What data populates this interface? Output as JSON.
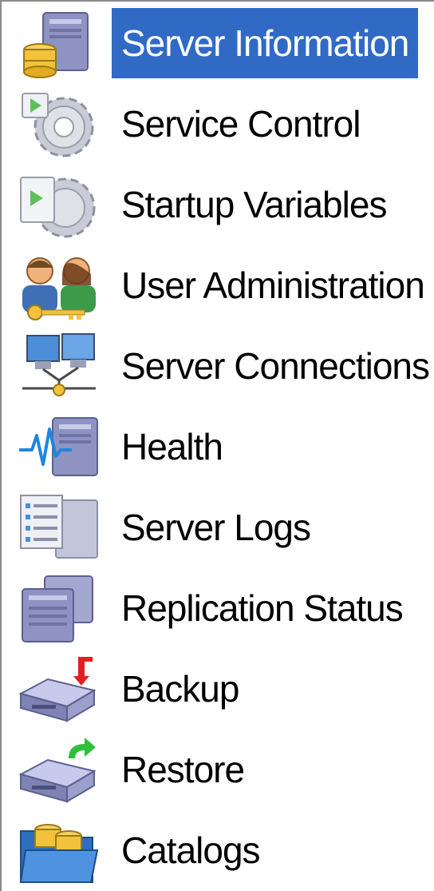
{
  "nav": {
    "items": [
      {
        "label": "Server Information",
        "icon": "server-database-icon",
        "selected": true
      },
      {
        "label": "Service Control",
        "icon": "service-gear-icon",
        "selected": false
      },
      {
        "label": "Startup Variables",
        "icon": "startup-gear-icon",
        "selected": false
      },
      {
        "label": "User Administration",
        "icon": "users-key-icon",
        "selected": false
      },
      {
        "label": "Server Connections",
        "icon": "network-computers-icon",
        "selected": false
      },
      {
        "label": "Health",
        "icon": "health-pulse-icon",
        "selected": false
      },
      {
        "label": "Server Logs",
        "icon": "log-documents-icon",
        "selected": false
      },
      {
        "label": "Replication Status",
        "icon": "replication-servers-icon",
        "selected": false
      },
      {
        "label": "Backup",
        "icon": "backup-drive-icon",
        "selected": false
      },
      {
        "label": "Restore",
        "icon": "restore-drive-icon",
        "selected": false
      },
      {
        "label": "Catalogs",
        "icon": "catalogs-folder-icon",
        "selected": false
      }
    ]
  },
  "colors": {
    "selection_background": "#316ac5",
    "selection_text": "#ffffff",
    "text": "#000000",
    "border": "#8a8a8a"
  }
}
